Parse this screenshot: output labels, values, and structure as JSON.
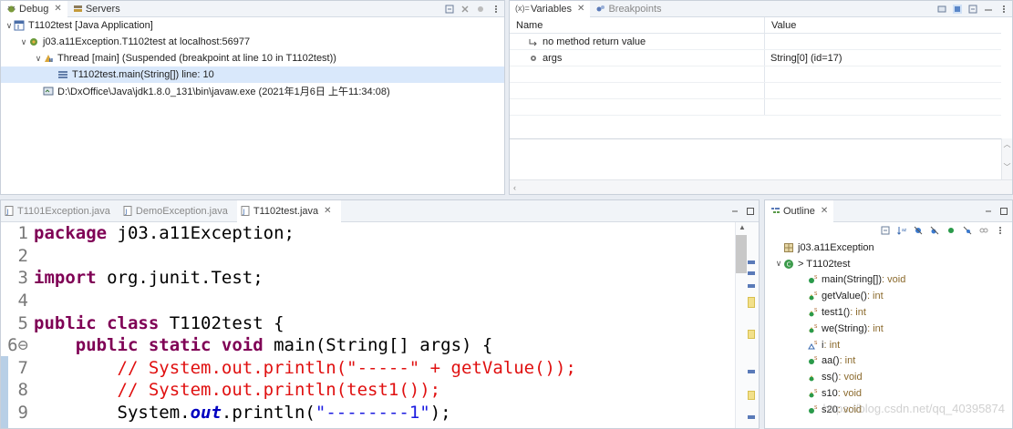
{
  "debug_panel": {
    "tabs": [
      {
        "label": "Debug",
        "icon": "debug-icon",
        "active": true
      },
      {
        "label": "Servers",
        "icon": "servers-icon",
        "active": false
      }
    ],
    "tree": [
      {
        "label": "T1102test [Java Application]",
        "icon": "java-app-icon",
        "indent": 0,
        "toggle": "expanded"
      },
      {
        "label": "j03.a11Exception.T1102test at localhost:56977",
        "icon": "debug-target-icon",
        "indent": 1,
        "toggle": "expanded"
      },
      {
        "label": "Thread [main] (Suspended (breakpoint at line 10 in T1102test))",
        "icon": "thread-suspended-icon",
        "indent": 2,
        "toggle": "expanded"
      },
      {
        "label": "T1102test.main(String[]) line: 10",
        "icon": "stack-frame-icon",
        "indent": 3,
        "toggle": "none",
        "selected": true
      },
      {
        "label": "D:\\DxOffice\\Java\\jdk1.8.0_131\\bin\\javaw.exe (2021年1月6日 上午11:34:08)",
        "icon": "process-icon",
        "indent": 2,
        "toggle": "none"
      }
    ]
  },
  "variables_panel": {
    "tabs": [
      {
        "label": "Variables",
        "icon": "variables-icon",
        "active": true
      },
      {
        "label": "Breakpoints",
        "icon": "breakpoints-icon",
        "active": false
      }
    ],
    "columns": [
      "Name",
      "Value"
    ],
    "rows": [
      {
        "name": "no method return value",
        "icon": "return-value-icon",
        "value": ""
      },
      {
        "name": "args",
        "icon": "local-variable-icon",
        "value": "String[0]  (id=17)"
      },
      {
        "name": "",
        "value": ""
      },
      {
        "name": "",
        "value": ""
      },
      {
        "name": "",
        "value": ""
      }
    ]
  },
  "editor": {
    "tabs": [
      {
        "label": "T1101Exception.java",
        "active": false
      },
      {
        "label": "DemoException.java",
        "active": false
      },
      {
        "label": "T1102test.java",
        "active": true
      }
    ],
    "lines": [
      {
        "num": "1",
        "parts": [
          {
            "t": "kw",
            "v": "package"
          },
          {
            "t": "txt",
            "v": " j03.a11Exception;"
          }
        ]
      },
      {
        "num": "2",
        "parts": []
      },
      {
        "num": "3",
        "parts": [
          {
            "t": "kw",
            "v": "import"
          },
          {
            "t": "txt",
            "v": " org.junit.Test;"
          }
        ]
      },
      {
        "num": "4",
        "parts": []
      },
      {
        "num": "5",
        "parts": [
          {
            "t": "kw",
            "v": "public class"
          },
          {
            "t": "txt",
            "v": " T1102test {"
          }
        ]
      },
      {
        "num": "6⊖",
        "parts": [
          {
            "t": "txt",
            "v": "    "
          },
          {
            "t": "kw",
            "v": "public static void"
          },
          {
            "t": "txt",
            "v": " main(String[] args) {"
          }
        ]
      },
      {
        "num": "7",
        "parts": [
          {
            "t": "cm",
            "v": "        // System.out.println(\"-----\" + getValue());"
          }
        ]
      },
      {
        "num": "8",
        "parts": [
          {
            "t": "cm",
            "v": "        // System.out.println(test1());"
          }
        ]
      },
      {
        "num": "9",
        "parts": [
          {
            "t": "txt",
            "v": "        System."
          },
          {
            "t": "fld",
            "v": "out"
          },
          {
            "t": "txt",
            "v": ".println("
          },
          {
            "t": "st",
            "v": "\"--------1\""
          },
          {
            "t": "txt",
            "v": ");"
          }
        ]
      }
    ]
  },
  "outline_panel": {
    "tab_label": "Outline",
    "items": [
      {
        "label": "j03.a11Exception",
        "meta": "",
        "icon": "package-icon",
        "indent": 0,
        "toggle": "none"
      },
      {
        "label": "> T1102test",
        "meta": "",
        "icon": "class-icon",
        "indent": 0,
        "toggle": "expanded"
      },
      {
        "label": "main(String[])",
        "meta": " : void",
        "icon": "public-static-method-icon",
        "indent": 1,
        "toggle": "none"
      },
      {
        "label": "getValue()",
        "meta": " : int",
        "icon": "protected-static-method-icon",
        "indent": 1,
        "toggle": "none"
      },
      {
        "label": "test1()",
        "meta": " : int",
        "icon": "protected-static-method-icon",
        "indent": 1,
        "toggle": "none"
      },
      {
        "label": "we(String)",
        "meta": " : int",
        "icon": "protected-static-method-icon",
        "indent": 1,
        "toggle": "none"
      },
      {
        "label": "i",
        "meta": " : int",
        "icon": "static-field-icon",
        "indent": 1,
        "toggle": "none"
      },
      {
        "label": "aa()",
        "meta": " : int",
        "icon": "public-static-method-icon",
        "indent": 1,
        "toggle": "none"
      },
      {
        "label": "ss()",
        "meta": " : void",
        "icon": "protected-method-icon",
        "indent": 1,
        "toggle": "none"
      },
      {
        "label": "s10",
        "meta": " : void",
        "icon": "protected-static-method-icon",
        "indent": 1,
        "toggle": "none"
      },
      {
        "label": "s20",
        "meta": " : void",
        "icon": "public-static-method-icon",
        "indent": 1,
        "toggle": "none"
      }
    ]
  },
  "watermark": "https://blog.csdn.net/qq_40395874"
}
